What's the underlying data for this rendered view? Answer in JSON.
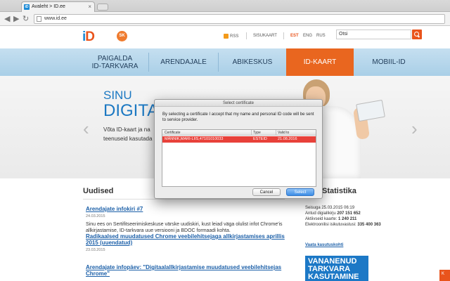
{
  "browser": {
    "tab_title": "Avaleht > ID.ee",
    "url": "www.id.ee",
    "back_glyph": "◀",
    "forward_glyph": "▶",
    "reload_glyph": "↻",
    "tab_close_glyph": "×",
    "favicon_text": "iD"
  },
  "header": {
    "logo_i": "i",
    "logo_d": "D",
    "lang_badge": "SK",
    "rss_label": "RSS",
    "sitemap_label": "SISUKAART",
    "languages": [
      "EST",
      "ENG",
      "RUS"
    ],
    "active_language": "EST",
    "search_value": "Otsi"
  },
  "nav": {
    "items": [
      {
        "label": "PAIGALDA\nID-TARKVARA"
      },
      {
        "label": "ARENDAJALE"
      },
      {
        "label": "ABIKESKUS"
      },
      {
        "label": "ID-KAART"
      },
      {
        "label": "MOBIIL-ID"
      }
    ],
    "active_index": 3
  },
  "hero": {
    "title_line1": "SINU",
    "title_line2": "DIGITA",
    "text_line1": "Võta ID-kaart ja na",
    "text_line2": "teenuseid kasutada",
    "prev_arrow": "‹",
    "next_arrow": "›"
  },
  "news": {
    "title": "Uudised",
    "items": [
      {
        "title": "Arendajate infokiri #7",
        "date": "24.03.2015",
        "summary": "Sinu ees on Sertifitseerimiskeskuse värske uudiskiri, kust leiad väga olulist infot Chrome'is allkirjastamise, ID-tarkvara uue versiooni ja BDOC formaadi kohta."
      },
      {
        "title": "Radikaalsed muudatused Chrome veebilehitsejaga allkirjastamises aprillis 2015 (uuendatud)",
        "date": "23.03.2015",
        "summary": ""
      },
      {
        "title": "Arendajate infopäev: \"Digitaalallkirjastamise muudatused veebilehitsejas Chrome\"",
        "date": "",
        "summary": ""
      }
    ]
  },
  "stats": {
    "title": "Statistika",
    "lines": [
      {
        "label": "Seisuga 25.03.2015 06:19",
        "value": ""
      },
      {
        "label": "Antud digiallkirju ",
        "value": "207 151 652"
      },
      {
        "label": "Aktiivseid kaarte: ",
        "value": "1 240 211"
      },
      {
        "label": "Elektroonilisi isikutuvastusi: ",
        "value": "335 400 363"
      }
    ],
    "link": "Vaata kasutuskohti",
    "banner_line1": "VANANENUD",
    "banner_line2": "TARKVARA",
    "banner_line3": "KASUTAMINE"
  },
  "float_badge": "K",
  "dialog": {
    "title": "Select certificate",
    "message": "By selecting a certificate I accept that my name and personal ID code will be sent to service provider.",
    "columns": [
      "Certificate",
      "Type",
      "Valid to"
    ],
    "rows": [
      {
        "certificate": "MÄNNIK,MARI-LIIS,47101010033",
        "type": "ESTEID",
        "valid_to": "21.08.2016"
      }
    ],
    "cancel_label": "Cancel",
    "select_label": "Select"
  },
  "colors": {
    "brand_blue": "#1b8ad6",
    "brand_orange": "#e9541c",
    "selected_row": "#e8413a"
  }
}
